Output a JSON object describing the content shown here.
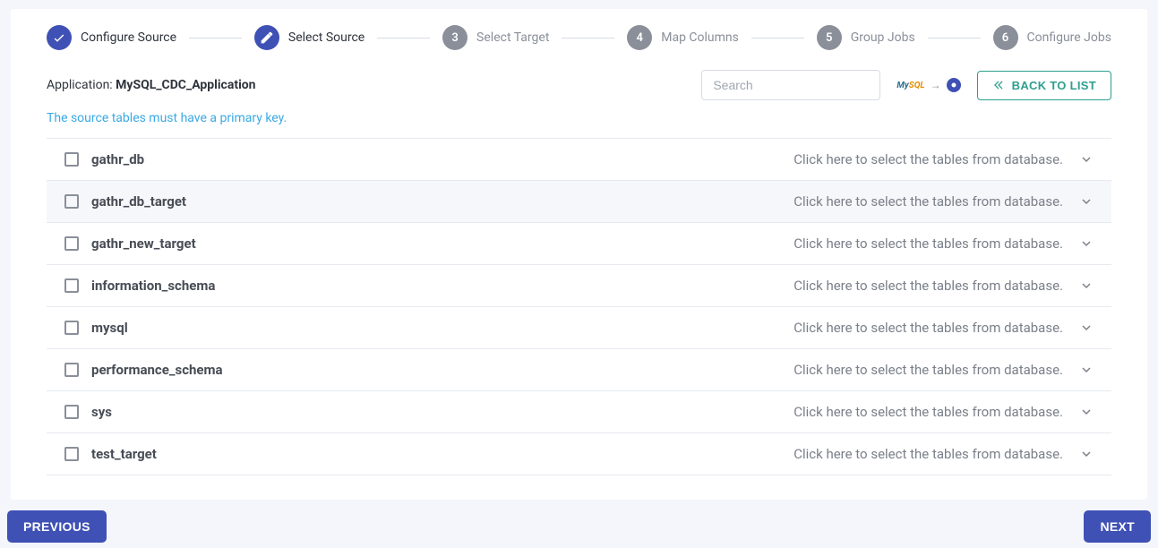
{
  "stepper": {
    "steps": [
      {
        "label": "Configure Source",
        "state": "done"
      },
      {
        "label": "Select Source",
        "state": "active"
      },
      {
        "label": "Select Target",
        "state": "pending",
        "num": "3"
      },
      {
        "label": "Map Columns",
        "state": "pending",
        "num": "4"
      },
      {
        "label": "Group Jobs",
        "state": "pending",
        "num": "5"
      },
      {
        "label": "Configure Jobs",
        "state": "pending",
        "num": "6"
      }
    ]
  },
  "header": {
    "app_label": "Application: ",
    "app_name": "MySQL_CDC_Application",
    "search_placeholder": "Search",
    "back_label": "BACK TO LIST",
    "source_glyph": "MySQL",
    "hint": "The source tables must have a primary key."
  },
  "databases": {
    "select_hint": "Click here to select the tables from database.",
    "items": [
      {
        "name": "gathr_db"
      },
      {
        "name": "gathr_db_target"
      },
      {
        "name": "gathr_new_target"
      },
      {
        "name": "information_schema"
      },
      {
        "name": "mysql"
      },
      {
        "name": "performance_schema"
      },
      {
        "name": "sys"
      },
      {
        "name": "test_target"
      }
    ]
  },
  "footer": {
    "prev": "PREVIOUS",
    "next": "NEXT"
  }
}
